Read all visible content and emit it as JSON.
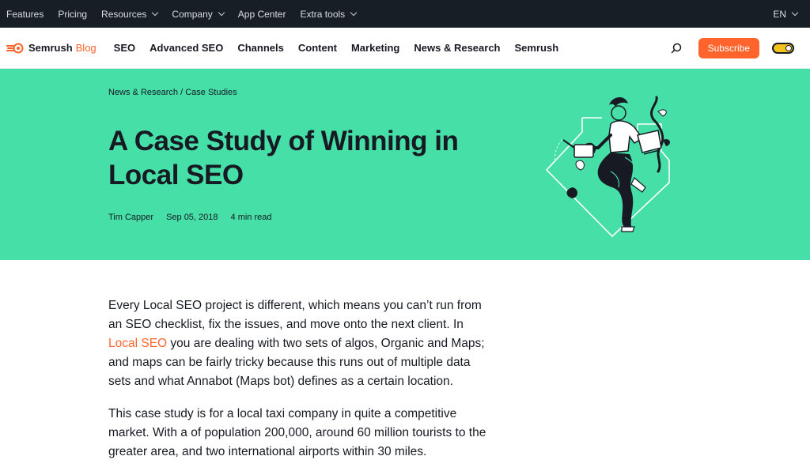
{
  "topbar": {
    "items": [
      "Features",
      "Pricing",
      "Resources",
      "Company",
      "App Center",
      "Extra tools"
    ],
    "language": "EN"
  },
  "nav": {
    "logo_text": "Semrush",
    "logo_blog": "Blog",
    "links": [
      "SEO",
      "Advanced SEO",
      "Channels",
      "Content",
      "Marketing",
      "News & Research",
      "Semrush"
    ],
    "subscribe_label": "Subscribe"
  },
  "hero": {
    "breadcrumb": [
      "News & Research",
      "Case Studies"
    ],
    "breadcrumb_sep": "/",
    "title": "A Case Study of Winning in Local SEO",
    "author": "Tim Capper",
    "date": "Sep 05, 2018",
    "read_time": "4 min read"
  },
  "article": {
    "p1_before": "Every Local SEO project is different, which means you can’t run from an SEO checklist, fix the issues, and move onto the next client. In ",
    "p1_link": "Local SEO",
    "p1_after": " you are dealing with two sets of algos, Organic and Maps; and maps can be fairly tricky because this runs out of multiple data sets and what Annabot (Maps bot) defines as a certain location.",
    "p2": "This case study is for a local taxi company in quite a competitive market. With a of population 200,000, around 60 million tourists to the greater area, and two international airports within 30 miles."
  },
  "colors": {
    "hero_bg": "#46dfa8",
    "accent": "#ff642d",
    "topbar_bg": "#181e25"
  }
}
